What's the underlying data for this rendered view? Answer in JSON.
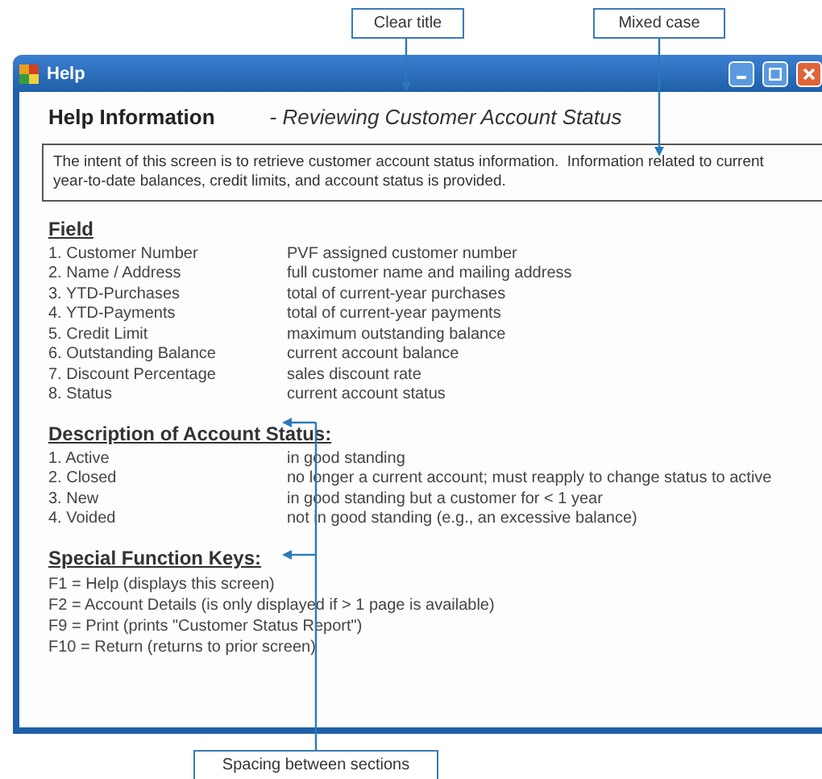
{
  "callouts": [
    "Clear title",
    "Mixed case",
    "Spacing between sections"
  ],
  "window": {
    "title": "Help"
  },
  "heading": "Help Information",
  "subtitle": "- Reviewing Customer Account Status",
  "intro": "The intent of this screen is to retrieve customer account status information.  Information related to current year-to-date balances, credit limits, and account status is provided.",
  "sections": [
    {
      "heading": "Field",
      "items": [
        {
          "term": "1. Customer Number",
          "desc": "PVF assigned customer number"
        },
        {
          "term": "2. Name / Address",
          "desc": "full customer name and mailing address"
        },
        {
          "term": "3. YTD-Purchases",
          "desc": "total of current-year purchases"
        },
        {
          "term": "4. YTD-Payments",
          "desc": "total of current-year payments"
        },
        {
          "term": "5. Credit Limit",
          "desc": "maximum outstanding balance"
        },
        {
          "term": "6. Outstanding Balance",
          "desc": "current account balance"
        },
        {
          "term": "7. Discount Percentage",
          "desc": "sales discount rate"
        },
        {
          "term": "8. Status",
          "desc": "current account status"
        }
      ]
    },
    {
      "heading": "Description of Account Status:",
      "items": [
        {
          "term": "1. Active",
          "desc": "in good standing"
        },
        {
          "term": "2. Closed",
          "desc": "no longer a current account; must reapply to change status to active"
        },
        {
          "term": "3. New",
          "desc": "in good standing but a customer for < 1 year"
        },
        {
          "term": "4. Voided",
          "desc": "not in good standing (e.g., an excessive balance)"
        }
      ]
    }
  ],
  "function_keys": {
    "heading": "Special Function Keys:",
    "lines": [
      "F1 = Help (displays this screen)",
      "F2 = Account Details (is only displayed if > 1 page is available)",
      "F9 = Print (prints \"Customer Status Report\")",
      "F10 = Return (returns to prior screen)"
    ]
  }
}
